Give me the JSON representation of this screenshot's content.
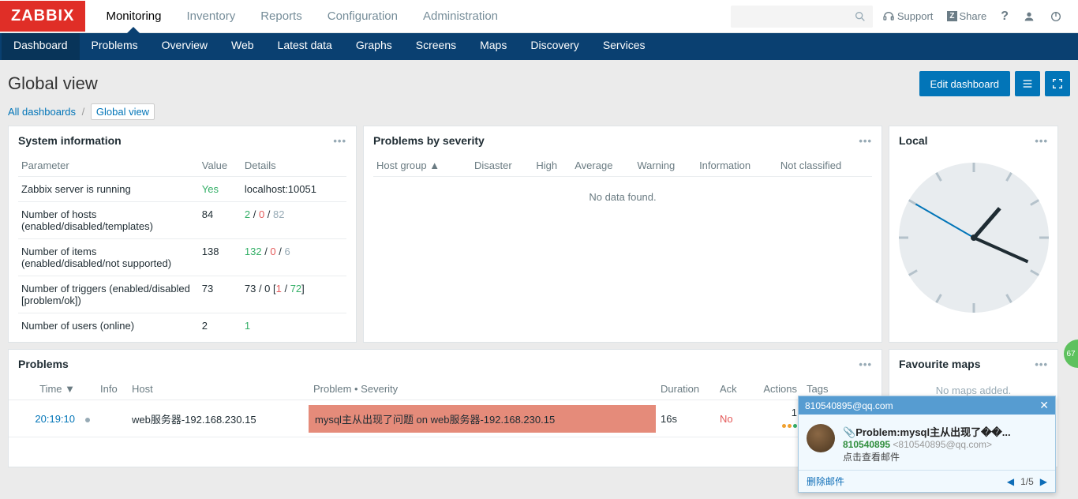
{
  "logo": "ZABBIX",
  "top_menu": [
    "Monitoring",
    "Inventory",
    "Reports",
    "Configuration",
    "Administration"
  ],
  "top_menu_active": 0,
  "top_right": {
    "support": "Support",
    "share": "Share"
  },
  "sub_menu": [
    "Dashboard",
    "Problems",
    "Overview",
    "Web",
    "Latest data",
    "Graphs",
    "Screens",
    "Maps",
    "Discovery",
    "Services"
  ],
  "sub_menu_active": 0,
  "page_title": "Global view",
  "edit_button": "Edit dashboard",
  "breadcrumb": {
    "all": "All dashboards",
    "current": "Global view"
  },
  "sysinfo": {
    "title": "System information",
    "headers": {
      "param": "Parameter",
      "value": "Value",
      "details": "Details"
    },
    "rows": [
      {
        "param": "Zabbix server is running",
        "value": "Yes",
        "value_class": "green",
        "details_html": "localhost:10051"
      },
      {
        "param": "Number of hosts (enabled/disabled/templates)",
        "value": "84",
        "details_html": "<span class='green'>2</span> / <span class='red'>0</span> / <span class='gray'>82</span>"
      },
      {
        "param": "Number of items (enabled/disabled/not supported)",
        "value": "138",
        "details_html": "<span class='green'>132</span> / <span class='red'>0</span> / <span class='gray'>6</span>"
      },
      {
        "param": "Number of triggers (enabled/disabled [problem/ok])",
        "value": "73",
        "details_html": "73 / 0 [<span class='red'>1</span> / <span class='green'>72</span>]"
      },
      {
        "param": "Number of users (online)",
        "value": "2",
        "details_html": "<span class='green'>1</span>"
      }
    ]
  },
  "severity": {
    "title": "Problems by severity",
    "headers": [
      "Host group ▲",
      "Disaster",
      "High",
      "Average",
      "Warning",
      "Information",
      "Not classified"
    ],
    "nodata": "No data found."
  },
  "local": {
    "title": "Local"
  },
  "problems": {
    "title": "Problems",
    "headers": {
      "time": "Time ▼",
      "info": "Info",
      "host": "Host",
      "problem": "Problem • Severity",
      "duration": "Duration",
      "ack": "Ack",
      "actions": "Actions",
      "tags": "Tags"
    },
    "row": {
      "time": "20:19:10",
      "host": "web服务器-192.168.230.15",
      "problem": "mysql主从出现了问题 on web服务器-192.168.230.15",
      "duration": "16s",
      "ack": "No",
      "actions": "1"
    }
  },
  "favmaps": {
    "title": "Favourite maps",
    "nomaps": "No maps added."
  },
  "notification": {
    "header": "810540895@qq.com",
    "attach_icon": "📎",
    "subject": "Problem:mysql主从出现了��...",
    "from_name": "810540895",
    "from_email": "<810540895@qq.com>",
    "hint": "点击查看邮件",
    "delete": "删除邮件",
    "page": "1/5"
  },
  "float_badge": "67"
}
